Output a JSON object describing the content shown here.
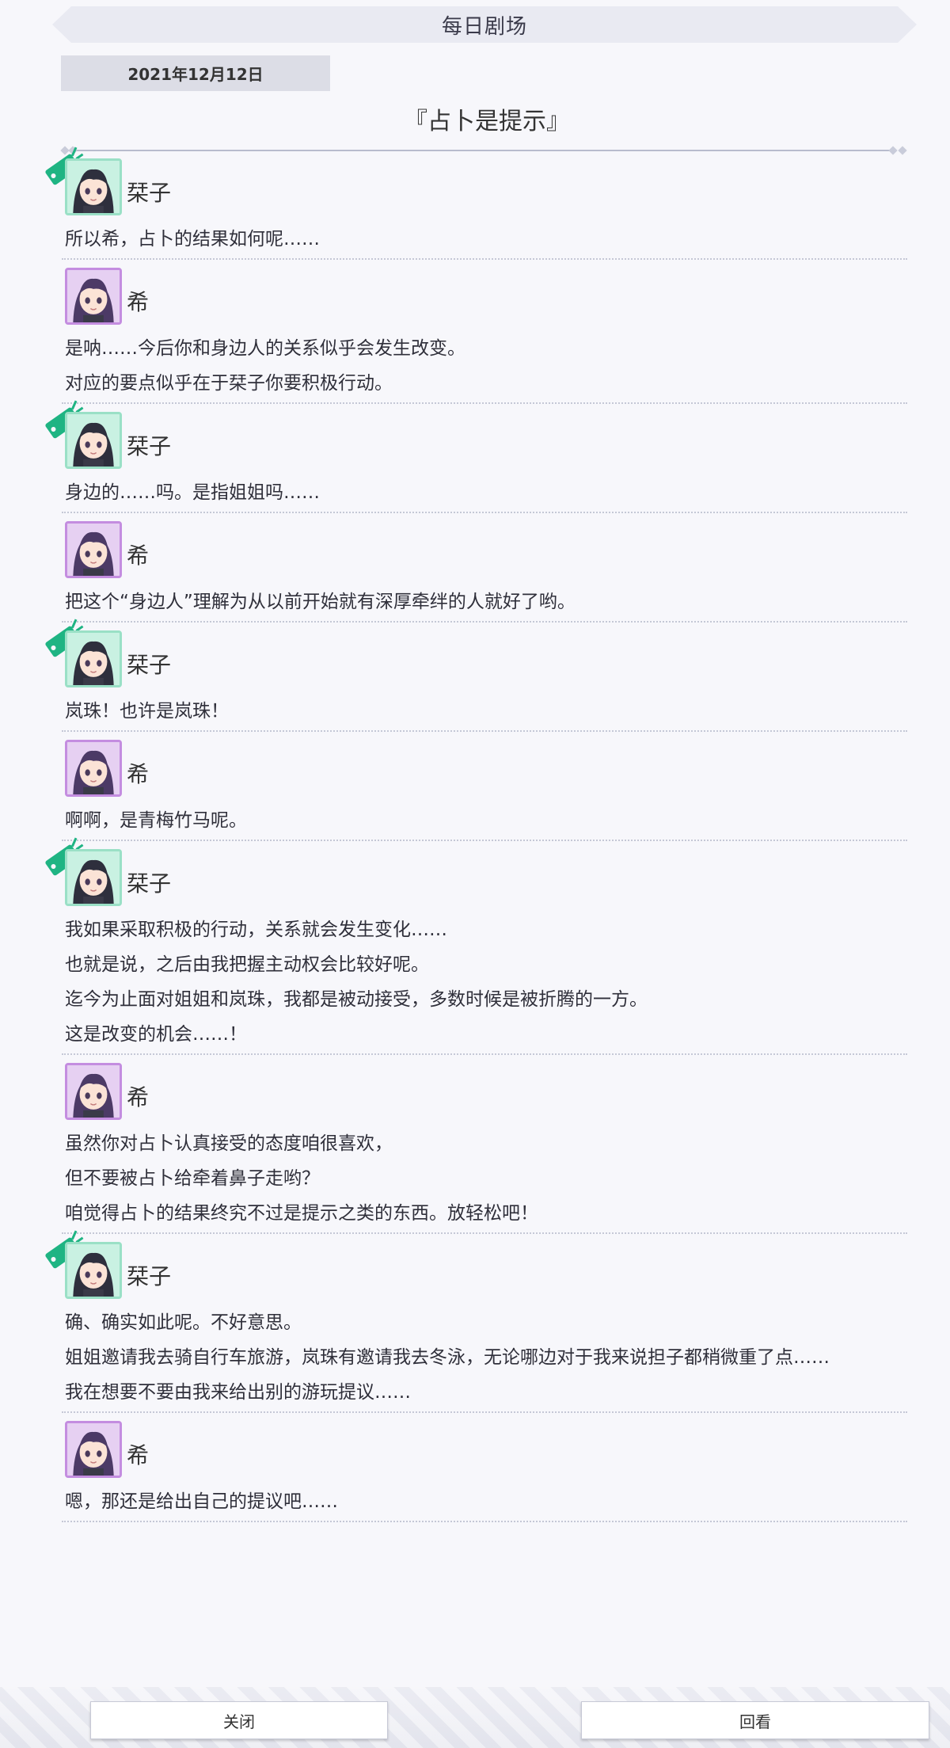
{
  "header": {
    "title": "每日剧场"
  },
  "date": "2021年12月12日",
  "episode_title": "『占卜是提示』",
  "colors": {
    "green_accent": "#1fb483",
    "purple_accent": "#9b5fc0"
  },
  "dialogue": [
    {
      "speaker": "栞子",
      "avatar": "green-avatar",
      "lines": [
        "所以希，占卜的结果如何呢……"
      ]
    },
    {
      "speaker": "希",
      "avatar": "purple-avatar",
      "lines": [
        "是呐……今后你和身边人的关系似乎会发生改变。",
        "对应的要点似乎在于栞子你要积极行动。"
      ]
    },
    {
      "speaker": "栞子",
      "avatar": "green-avatar",
      "lines": [
        "身边的……吗。是指姐姐吗……"
      ]
    },
    {
      "speaker": "希",
      "avatar": "purple-avatar",
      "lines": [
        "把这个“身边人”理解为从以前开始就有深厚牵绊的人就好了哟。"
      ]
    },
    {
      "speaker": "栞子",
      "avatar": "green-avatar",
      "lines": [
        "岚珠！也许是岚珠！"
      ]
    },
    {
      "speaker": "希",
      "avatar": "purple-avatar",
      "lines": [
        "啊啊，是青梅竹马呢。"
      ]
    },
    {
      "speaker": "栞子",
      "avatar": "green-avatar",
      "lines": [
        "我如果采取积极的行动，关系就会发生变化……",
        "也就是说，之后由我把握主动权会比较好呢。",
        "迄今为止面对姐姐和岚珠，我都是被动接受，多数时候是被折腾的一方。",
        "这是改变的机会……！"
      ]
    },
    {
      "speaker": "希",
      "avatar": "purple-avatar",
      "lines": [
        "虽然你对占卜认真接受的态度咱很喜欢，",
        "但不要被占卜给牵着鼻子走哟？",
        "咱觉得占卜的结果终究不过是提示之类的东西。放轻松吧！"
      ]
    },
    {
      "speaker": "栞子",
      "avatar": "green-avatar",
      "lines": [
        "确、确实如此呢。不好意思。",
        "姐姐邀请我去骑自行车旅游，岚珠有邀请我去冬泳，无论哪边对于我来说担子都稍微重了点……",
        "我在想要不要由我来给出别的游玩提议……"
      ]
    },
    {
      "speaker": "希",
      "avatar": "purple-avatar",
      "lines": [
        "嗯，那还是给出自己的提议吧……"
      ]
    }
  ],
  "buttons": {
    "close": "关闭",
    "review": "回看"
  }
}
